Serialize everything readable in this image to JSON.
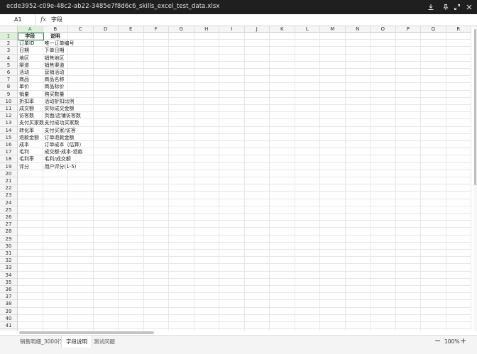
{
  "window": {
    "title": "ecde3952-c09e-48c2-ab22-3485e7f8d6c6_skills_excel_test_data.xlsx",
    "icons": [
      "download-icon",
      "pin-icon",
      "expand-icon",
      "close-icon"
    ]
  },
  "formula_bar": {
    "cell_ref": "A1",
    "fx_label": "fx",
    "content": "字段"
  },
  "grid": {
    "selected_cell": "A1",
    "columns": [
      "A",
      "B",
      "C",
      "D",
      "E",
      "F",
      "G",
      "H",
      "I",
      "J",
      "K",
      "L",
      "M",
      "N",
      "O",
      "P",
      "Q",
      "R"
    ],
    "row_count": 42,
    "cells": [
      [
        "字段",
        "说明"
      ],
      [
        "订单ID",
        "唯一订单编号"
      ],
      [
        "日期",
        "下单日期"
      ],
      [
        "地区",
        "销售地区"
      ],
      [
        "渠道",
        "销售渠道"
      ],
      [
        "活动",
        "营销活动"
      ],
      [
        "商品",
        "商品名称"
      ],
      [
        "单价",
        "商品标价"
      ],
      [
        "销量",
        "购买数量"
      ],
      [
        "折扣率",
        "活动折扣比例"
      ],
      [
        "成交额",
        "实际成交金额"
      ],
      [
        "访客数",
        "页面/店铺访客数"
      ],
      [
        "支付买家数",
        "支付成功买家数"
      ],
      [
        "转化率",
        "支付买家/访客"
      ],
      [
        "退款金额",
        "订单退款金额"
      ],
      [
        "成本",
        "订单成本（估算）"
      ],
      [
        "毛利",
        "成交额-成本-退款"
      ],
      [
        "毛利率",
        "毛利/成交额"
      ],
      [
        "评分",
        "用户评分(1-5)"
      ]
    ]
  },
  "sheets": {
    "tabs": [
      "销售明细_3000行",
      "字段说明",
      "测试问题"
    ],
    "active_index": 1
  },
  "zoom": {
    "minus": "−",
    "level": "100%",
    "plus": "+"
  }
}
